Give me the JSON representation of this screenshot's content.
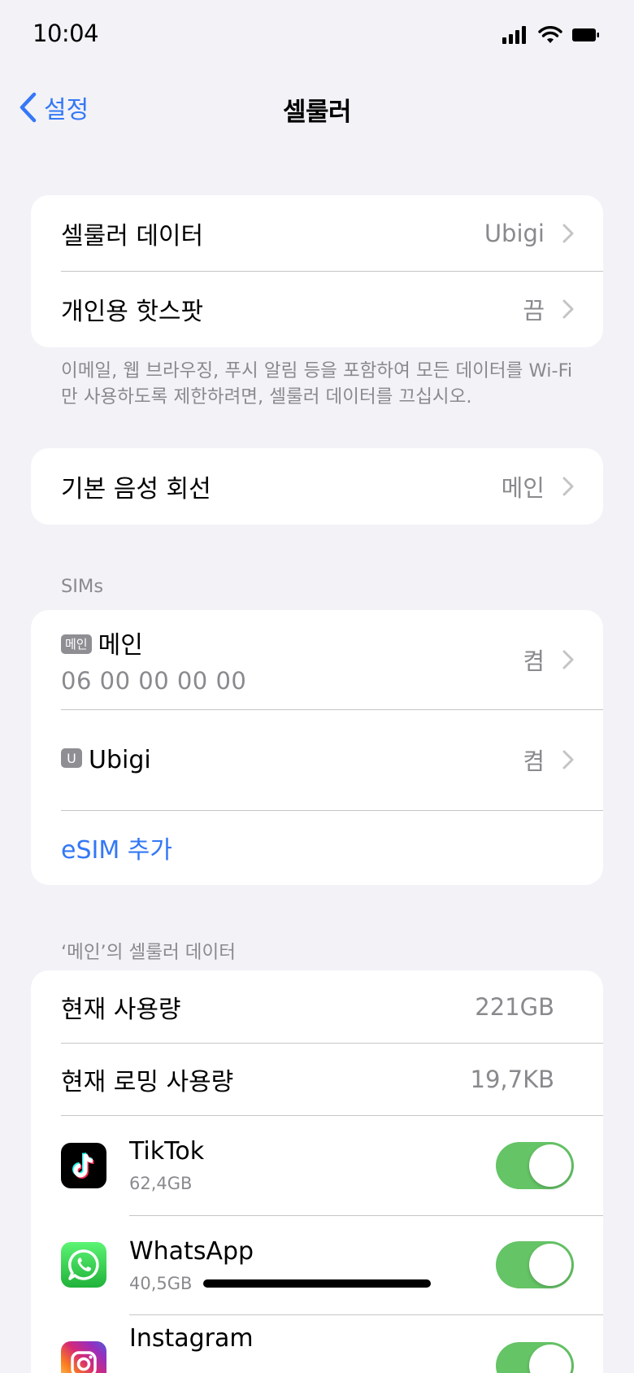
{
  "status_bar": {
    "time": "10:04"
  },
  "nav": {
    "back_label": "설정",
    "title": "셀룰러"
  },
  "group1": {
    "cellular_data": {
      "label": "셀룰러 데이터",
      "value": "Ubigi"
    },
    "hotspot": {
      "label": "개인용 핫스팟",
      "value": "끔"
    },
    "footer": "이메일, 웹 브라우징, 푸시 알림 등을 포함하여 모든 데이터를 Wi-Fi만 사용하도록 제한하려면, 셀룰러 데이터를 끄십시오."
  },
  "group2": {
    "default_voice": {
      "label": "기본 음성 회선",
      "value": "메인"
    }
  },
  "sims": {
    "header": "SIMs",
    "items": [
      {
        "badge": "메인",
        "name": "메인",
        "number": "06 00 00 00 00",
        "value": "켬"
      },
      {
        "badge": "U",
        "name": "Ubigi",
        "value": "켬"
      }
    ],
    "add_esim": "eSIM 추가"
  },
  "usage": {
    "header": "‘메인’의 셀룰러 데이터",
    "current": {
      "label": "현재 사용량",
      "value": "221GB"
    },
    "roaming": {
      "label": "현재 로밍 사용량",
      "value": "19,7KB"
    },
    "apps": [
      {
        "name": "TikTok",
        "usage": "62,4GB",
        "enabled": true,
        "icon": "tiktok-icon",
        "color": "#000000"
      },
      {
        "name": "WhatsApp",
        "usage": "40,5GB",
        "enabled": true,
        "icon": "whatsapp-icon",
        "color": "#25d366"
      },
      {
        "name": "Instagram",
        "usage": "",
        "enabled": true,
        "icon": "instagram-icon",
        "color": "#d62976"
      }
    ]
  },
  "colors": {
    "accent": "#3478f6",
    "toggle_on": "#65c466",
    "background": "#f2f2f7"
  }
}
